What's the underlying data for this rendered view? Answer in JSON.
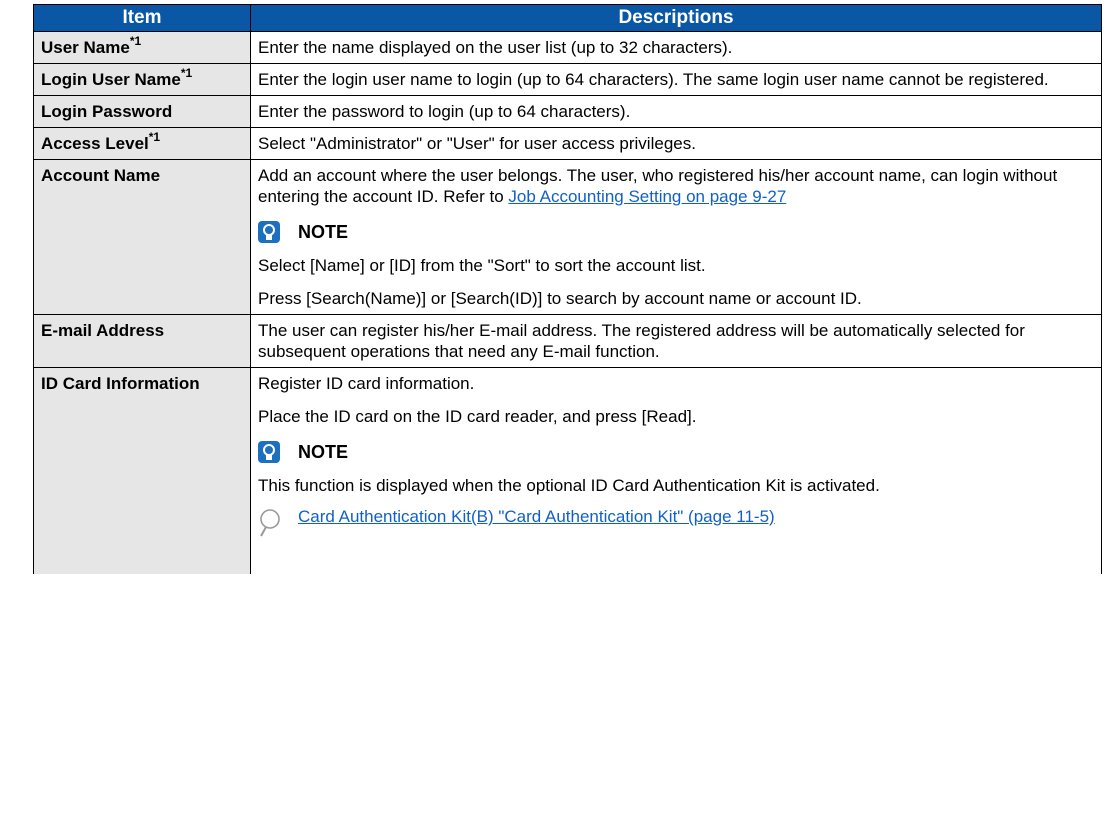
{
  "header": {
    "item": "Item",
    "descriptions": "Descriptions"
  },
  "footnote_mark": "*1",
  "note_label": "NOTE",
  "rows": [
    {
      "item": "User Name",
      "desc": "Enter the name displayed on the user list (up to 32 characters)."
    },
    {
      "item": "Login User Name",
      "desc": "Enter the login user name to login (up to 64 characters). The same login user name cannot be registered."
    },
    {
      "item": "Login Password",
      "desc": "Enter the password to login (up to 64 characters)."
    },
    {
      "item": "Access Level",
      "desc": "Select \"Administrator\" or \"User\" for user access privileges."
    },
    {
      "item": "Account Name",
      "desc_pre": "Add an account where the user belongs. The user, who registered his/her account name, can login without entering the account ID. Refer to ",
      "desc_link": "Job Accounting Setting on page 9-27",
      "note_1": "Select [Name] or [ID] from the \"Sort\" to sort the account list.",
      "note_2": "Press [Search(Name)] or [Search(ID)] to search by account name or account ID."
    },
    {
      "item": "E-mail Address",
      "desc": "The user can register his/her E-mail address. The registered address will be automatically selected for subsequent operations that need any E-mail function."
    },
    {
      "item": "ID Card Information",
      "desc_1": "Register ID card information.",
      "desc_2": "Place the ID card on the ID card reader, and press [Read].",
      "note_1": "This function is displayed when the optional ID Card Authentication Kit is activated.",
      "ref_link": "Card Authentication Kit(B) \"Card Authentication Kit\" (page 11-5)"
    }
  ]
}
